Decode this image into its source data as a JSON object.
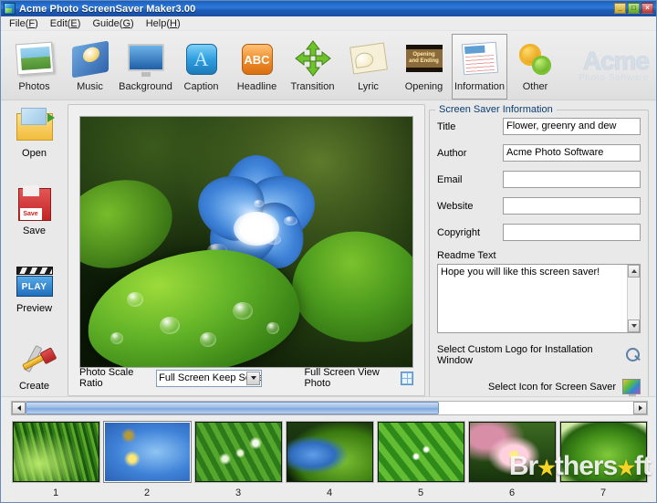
{
  "window": {
    "title": "Acme Photo ScreenSaver Maker3.00",
    "app_icon": "app-icon",
    "minimize": "_",
    "maximize": "□",
    "close": "×"
  },
  "menu": {
    "items": [
      {
        "label": "File(F)",
        "text": "File(",
        "accel": "F",
        "tail": ")"
      },
      {
        "label": "Edit(E)",
        "text": "Edit(",
        "accel": "E",
        "tail": ")"
      },
      {
        "label": "Guide(G)",
        "text": "Guide(",
        "accel": "G",
        "tail": ")"
      },
      {
        "label": "Help(H)",
        "text": "Help(",
        "accel": "H",
        "tail": ")"
      }
    ]
  },
  "toolbar": {
    "items": [
      {
        "label": "Photos",
        "icon": "photos-icon",
        "selected": false
      },
      {
        "label": "Music",
        "icon": "music-icon",
        "selected": false
      },
      {
        "label": "Background",
        "icon": "background-icon",
        "selected": false
      },
      {
        "label": "Caption",
        "icon": "caption-icon",
        "selected": false
      },
      {
        "label": "Headline",
        "icon": "headline-icon",
        "selected": false
      },
      {
        "label": "Transition",
        "icon": "transition-icon",
        "selected": false
      },
      {
        "label": "Lyric",
        "icon": "lyric-icon",
        "selected": false
      },
      {
        "label": "Opening",
        "icon": "opening-icon",
        "selected": false
      },
      {
        "label": "Information",
        "icon": "information-icon",
        "selected": true
      },
      {
        "label": "Other",
        "icon": "other-icon",
        "selected": false
      }
    ],
    "caption_glyph": "A",
    "headline_glyph": "ABC",
    "opening_text_line1": "Opening",
    "opening_text_line2": "and Ending",
    "logo_main": "Acme",
    "logo_sub": "Photo Software"
  },
  "rail": {
    "items": [
      {
        "label": "Open",
        "icon": "open-folder-icon"
      },
      {
        "label": "Save",
        "icon": "save-floppy-icon",
        "badge": "Save"
      },
      {
        "label": "Preview",
        "icon": "preview-clapper-icon",
        "badge": "PLAY"
      },
      {
        "label": "Create",
        "icon": "create-tools-icon"
      }
    ]
  },
  "preview": {
    "scale_label": "Photo Scale Ratio",
    "scale_value": "Full Screen Keep Scale R",
    "fullscreen_label": "Full Screen View Photo",
    "fullscreen_icon": "grid-icon",
    "photo_alt": "blue flower with dew on green leaves"
  },
  "info_panel": {
    "group_title": "Screen Saver Information",
    "fields": [
      {
        "label": "Title",
        "value": "Flower, greenry and dew",
        "placeholder": ""
      },
      {
        "label": "Author",
        "value": "Acme Photo Software",
        "placeholder": ""
      },
      {
        "label": "Email",
        "value": "",
        "placeholder": ""
      },
      {
        "label": "Website",
        "value": "",
        "placeholder": ""
      },
      {
        "label": "Copyright",
        "value": "",
        "placeholder": ""
      }
    ],
    "readme_label": "Readme Text",
    "readme_value": "Hope you will like this screen saver!",
    "custom_logo_label": "Select Custom Logo for Installation Window",
    "custom_logo_icon": "magnifier-icon",
    "screensaver_icon_label": "Select Icon for Screen Saver",
    "screensaver_icon": "monitor-picture-icon"
  },
  "strip": {
    "scroll_left": "◀",
    "scroll_right": "▶",
    "scroll_thumb_percent": 68,
    "thumbnails": [
      {
        "num": "1",
        "art": "t1",
        "selected": false,
        "alt": "dewy green grass"
      },
      {
        "num": "2",
        "art": "t2",
        "selected": true,
        "alt": "blue flowers with dew"
      },
      {
        "num": "3",
        "art": "t3",
        "selected": false,
        "alt": "lily of the valley"
      },
      {
        "num": "4",
        "art": "t4",
        "selected": false,
        "alt": "blue flower and leaves"
      },
      {
        "num": "5",
        "art": "t5",
        "selected": false,
        "alt": "green blades with water drops"
      },
      {
        "num": "6",
        "art": "t6",
        "selected": false,
        "alt": "pink flower in grass"
      },
      {
        "num": "7",
        "art": "t7",
        "selected": false,
        "alt": "green leaf with dew"
      }
    ],
    "watermark_a": "Br",
    "watermark_star": "★",
    "watermark_b": "thers",
    "watermark_star2": "★",
    "watermark_c": "ft"
  },
  "colors": {
    "titlebar_blue": "#1c5cb6",
    "accent_blue": "#0a3d73",
    "panel_bg": "#e9e9e9",
    "field_bg": "#ffffff"
  }
}
